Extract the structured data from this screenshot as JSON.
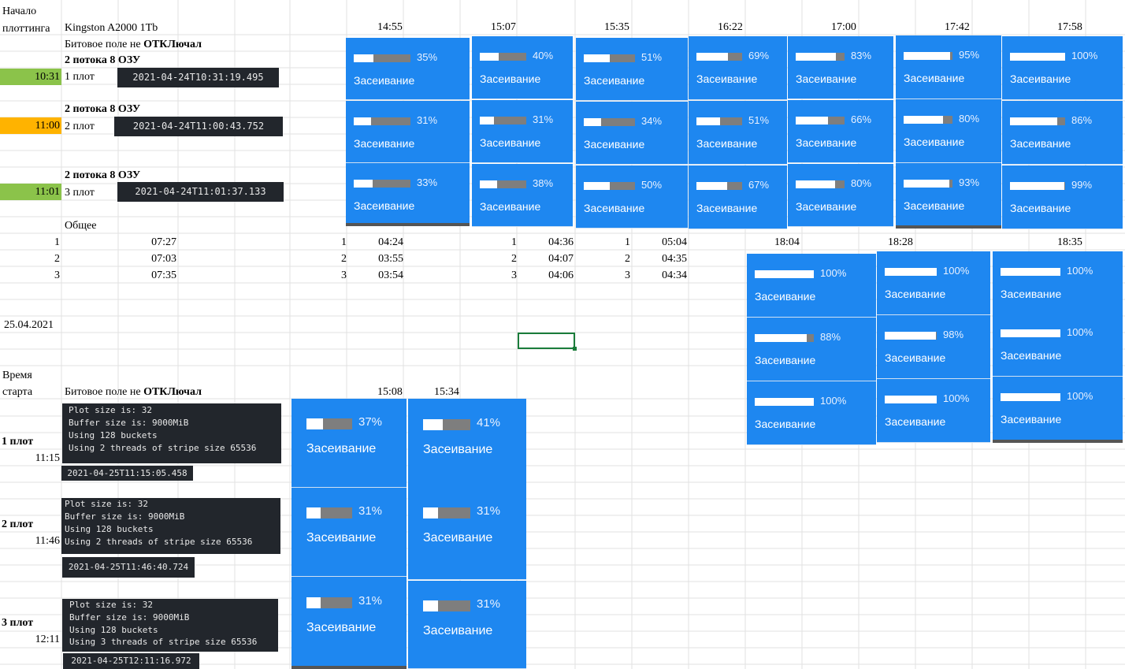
{
  "sheet": {
    "a_header_line1": "Начало",
    "a_header_line2": "плоттинга",
    "drive_name": "Kingston A2000 1Tb",
    "bitfield_prefix": "Битовое поле не ",
    "bitfield_bold": "ОТКЛючал",
    "threads_ram": "2 потока 8 ОЗУ",
    "total_label": "Общее",
    "date_label": "25.04.2021",
    "start_time_line1": "Время",
    "start_time_line2": "старта",
    "plots": [
      {
        "time": "10:31",
        "name": "1 плот",
        "timestamp": "2021-04-24T10:31:19.495",
        "color": "#8bc34a"
      },
      {
        "time": "11:00",
        "name": "2 плот",
        "timestamp": "2021-04-24T11:00:43.752",
        "color": "#ffb300"
      },
      {
        "time": "11:01",
        "name": "3 плот",
        "timestamp": "2021-04-24T11:01:37.133",
        "color": "#8bc34a"
      }
    ],
    "times_top": [
      "14:55",
      "15:07",
      "15:35",
      "16:22",
      "17:00",
      "17:42",
      "17:58"
    ],
    "times_mid": [
      "18:04",
      "18:28",
      "18:35"
    ],
    "times_bottom": [
      "15:08",
      "15:34"
    ],
    "totals_rows": [
      {
        "idx": "1",
        "total": "07:27",
        "g": [
          {
            "i": "1",
            "v": "04:24"
          },
          {
            "i": "1",
            "v": "04:36"
          },
          {
            "i": "1",
            "v": "05:04"
          }
        ]
      },
      {
        "idx": "2",
        "total": "07:03",
        "g": [
          {
            "i": "2",
            "v": "03:55"
          },
          {
            "i": "2",
            "v": "04:07"
          },
          {
            "i": "2",
            "v": "04:35"
          }
        ]
      },
      {
        "idx": "3",
        "total": "07:35",
        "g": [
          {
            "i": "3",
            "v": "03:54"
          },
          {
            "i": "3",
            "v": "04:06"
          },
          {
            "i": "3",
            "v": "04:34"
          }
        ]
      }
    ],
    "bottom_plots": [
      {
        "name": "1 плот",
        "time": "11:15",
        "timestamp": "2021-04-25T11:15:05.458",
        "log": [
          "Plot size is: 32",
          "Buffer size is: 9000MiB",
          "Using 128 buckets",
          "Using 2 threads of stripe size 65536"
        ]
      },
      {
        "name": "2 плот",
        "time": "11:46",
        "timestamp": "2021-04-25T11:46:40.724",
        "log": [
          "Plot size is: 32",
          "Buffer size is: 9000MiB",
          "Using 128 buckets",
          "Using 2 threads of stripe size 65536"
        ]
      },
      {
        "name": "3 плот",
        "time": "12:11",
        "timestamp": "2021-04-25T12:11:16.972",
        "log": [
          "Plot size is: 32",
          "Buffer size is: 9000MiB",
          "Using 128 buckets",
          "Using 3 threads of stripe size 65536"
        ]
      }
    ]
  },
  "seeding_label": "Засеивание",
  "progress_top": [
    [
      "35%",
      "31%",
      "33%"
    ],
    [
      "40%",
      "31%",
      "38%"
    ],
    [
      "51%",
      "34%",
      "50%"
    ],
    [
      "69%",
      "51%",
      "67%"
    ],
    [
      "83%",
      "66%",
      "80%"
    ],
    [
      "95%",
      "80%",
      "93%"
    ],
    [
      "100%",
      "86%",
      "99%"
    ]
  ],
  "progress_mid": [
    [
      "100%",
      "88%",
      "100%"
    ],
    [
      "100%",
      "98%",
      "100%"
    ],
    [
      "100%",
      "100%",
      "100%"
    ]
  ],
  "progress_bottom": [
    [
      "37%",
      "31%",
      "31%"
    ],
    [
      "41%",
      "31%",
      "31%"
    ]
  ],
  "colors": {
    "card_blue": "#1e87f0",
    "terminal": "#22262c",
    "grid": "#e2e2e2",
    "selection": "#1a7c3a"
  }
}
